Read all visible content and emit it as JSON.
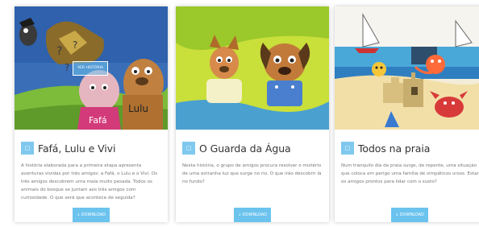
{
  "cards": [
    {
      "title": "Fafá, Lulu e Vivi",
      "description": "A história elaborada para a primeira etapa apresenta aventuras vividas por três amigos: a Fafá, o Lulu e o Vivi. Os três amigos descobrem uma mala muito pesada. Todos os animais do bosque se juntam aos três amigos com curiosidade. O que será que acontece de seguida?",
      "download_label": "↓ DOWNLOAD",
      "overlay_label": "VER HISTÓRIA",
      "illustration_labels": [
        "Fafá",
        "Lulu"
      ]
    },
    {
      "title": "O Guarda da Água",
      "description": "Nesta história, o grupo de amigos procura resolver o mistério de uma estranha luz que surge no rio. O que irão descobrir lá no fundo?",
      "download_label": "↓ DOWNLOAD"
    },
    {
      "title": "Todos na praia",
      "description": "Num tranquilo dia de praia surge, de repente, uma situação que coloca em perigo uma família de simpáticos ursos. Estarão os amigos prontos para lidar com o susto?",
      "download_label": "↓ DOWNLOAD"
    }
  ],
  "icons": {
    "title_icon": "book-icon",
    "download_icon": "download-arrow-icon"
  },
  "colors": {
    "accent": "#6bc3ee",
    "title_text": "#333333",
    "body_text": "#777777"
  }
}
